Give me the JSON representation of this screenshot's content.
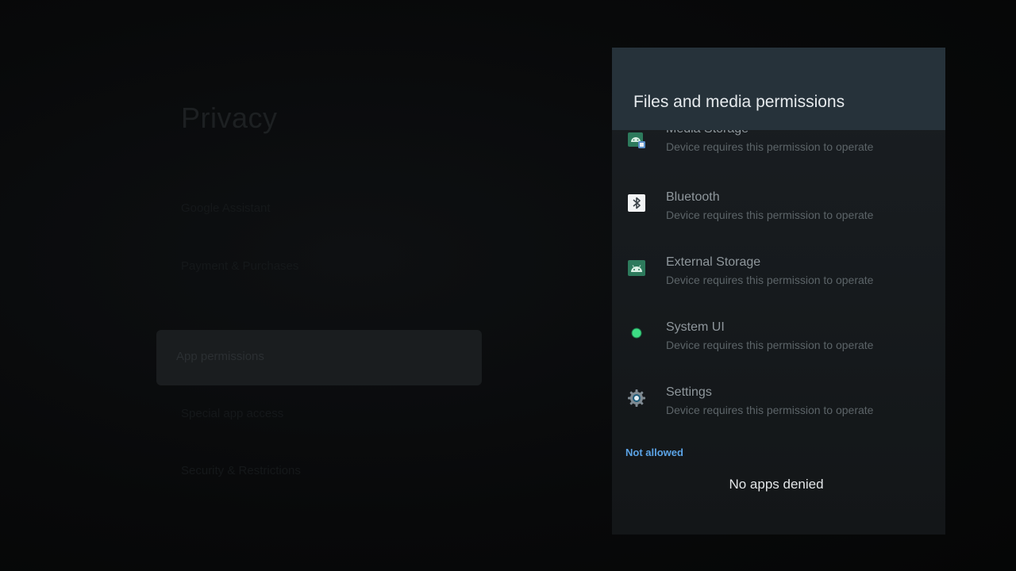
{
  "left_menu": {
    "title": "Privacy",
    "items": [
      {
        "label": "Google Assistant"
      },
      {
        "label": "Payment & Purchases"
      },
      {
        "label": "App permissions"
      },
      {
        "label": "Special app access"
      },
      {
        "label": "Security & Restrictions"
      }
    ]
  },
  "panel": {
    "title": "Files and media permissions",
    "permissions": [
      {
        "name": "Media Storage",
        "description": "Device requires this permission to operate",
        "icon": "android-media-icon"
      },
      {
        "name": "Bluetooth",
        "description": "Device requires this permission to operate",
        "icon": "bluetooth-icon"
      },
      {
        "name": "External Storage",
        "description": "Device requires this permission to operate",
        "icon": "android-icon"
      },
      {
        "name": "System UI",
        "description": "Device requires this permission to operate",
        "icon": "green-dot-icon"
      },
      {
        "name": "Settings",
        "description": "Device requires this permission to operate",
        "icon": "gear-icon"
      }
    ],
    "not_allowed_label": "Not allowed",
    "empty_state": "No apps denied"
  },
  "colors": {
    "accent": "#5ba3e6",
    "header_bg": "#26323a",
    "android_green": "#3ddc84"
  }
}
